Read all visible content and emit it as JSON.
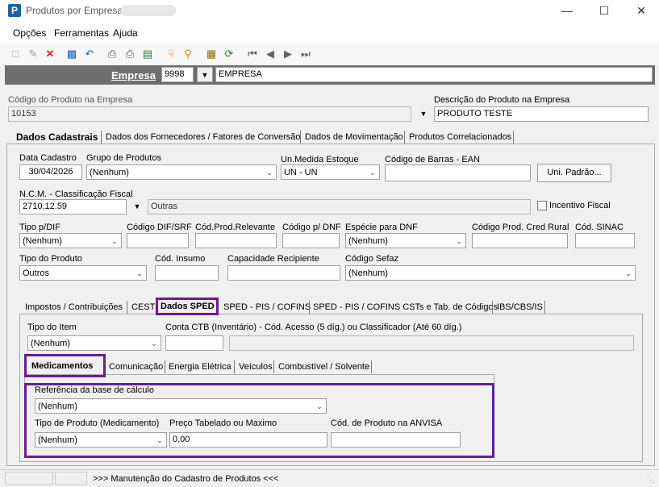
{
  "window": {
    "title": "Produtos por Empresa",
    "minimize": "—",
    "maximize": "☐",
    "close": "✕"
  },
  "menu": [
    "Opções",
    "Ferramentas",
    "Ajuda"
  ],
  "empresa": {
    "label": "Empresa",
    "code": "9998",
    "name": "EMPRESA"
  },
  "header": {
    "codigo_label": "Código do Produto na Empresa",
    "codigo_value": "10153",
    "descricao_label": "Descrição do Produto na Empresa",
    "descricao_value": "PRODUTO TESTE"
  },
  "main_tabs": [
    "Dados Cadastrais",
    "Dados dos Fornecedores / Fatores de Conversão",
    "Dados de Movimentação",
    "Produtos Correlacionados"
  ],
  "cad": {
    "data_cadastro_label": "Data Cadastro",
    "data_cadastro_value": "30/04/2026",
    "grupo_label": "Grupo de Produtos",
    "grupo_value": "(Nenhum)",
    "unmedida_label": "Un.Medida Estoque",
    "unmedida_value": "UN - UN",
    "ean_label": "Código de Barras - EAN",
    "ean_value": "",
    "uni_padrao_button": "Uni. Padrão...",
    "ncm_label": "N.C.M. -  Classificação Fiscal",
    "ncm_value": "2710.12.59",
    "ncm_desc": "Outras",
    "incentivo_label": "Incentivo Fiscal",
    "tipo_dif_label": "Tipo p/DIF",
    "tipo_dif_value": "(Nenhum)",
    "cod_dif_label": "Código DIF/SRF",
    "cod_relevante_label": "Cód.Prod.Relevante",
    "cod_dnf_label": "Código p/ DNF",
    "especie_dnf_label": "Espécie para DNF",
    "especie_dnf_value": "(Nenhum)",
    "cod_rural_label": "Código Prod. Cred Rural",
    "cod_sinac_label": "Cód. SINAC",
    "tipo_produto_label": "Tipo do Produto",
    "tipo_produto_value": "Outros",
    "cod_insumo_label": "Cód. Insumo",
    "capacidade_label": "Capacidade Recipiente",
    "cod_sefaz_label": "Código Sefaz",
    "cod_sefaz_value": "(Nenhum)"
  },
  "sub_tabs": [
    "Impostos / Contribuições",
    "CEST",
    "Dados SPED",
    "SPED - PIS / COFINS",
    "SPED - PIS / COFINS CSTs e Tab. de Códigos",
    "IBS/CBS/IS"
  ],
  "sped": {
    "tipo_item_label": "Tipo do Item",
    "tipo_item_value": "(Nenhum)",
    "conta_ctb_label": "Conta CTB (Inventário) - Cód. Acesso (5 díg.) ou Classificador (Até 60 díg.)"
  },
  "sped_tabs": [
    "Medicamentos",
    "Comunicação",
    "Energia Elétrica",
    "Veículos",
    "Combustível / Solvente"
  ],
  "med": {
    "ref_label": "Referência da base de cálculo",
    "ref_value": "(Nenhum)",
    "tipo_med_label": "Tipo de Produto (Medicamento)",
    "tipo_med_value": "(Nenhum)",
    "preco_label": "Preço Tabelado ou Maximo",
    "preco_value": "0,00",
    "anvisa_label": "Cód. de Produto na ANVISA"
  },
  "status": {
    "text": ">>> Manutenção do Cadastro de Produtos <<<"
  },
  "colors": {
    "highlight": "#6a1b9a",
    "empresa_bar": "#6e6e6e",
    "app_icon": "#1f5fa6"
  }
}
